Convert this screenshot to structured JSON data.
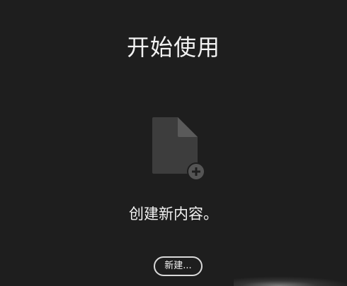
{
  "start": {
    "title": "开始使用",
    "subtitle": "创建新内容。",
    "new_button_label": "新建..."
  },
  "icons": {
    "document": "document-add-icon"
  },
  "colors": {
    "background": "#1e1e1e",
    "icon_fill": "#3d3d3d",
    "icon_fold": "#5a5a5a",
    "plus_badge": "#555555",
    "text": "#f2f2f2"
  }
}
